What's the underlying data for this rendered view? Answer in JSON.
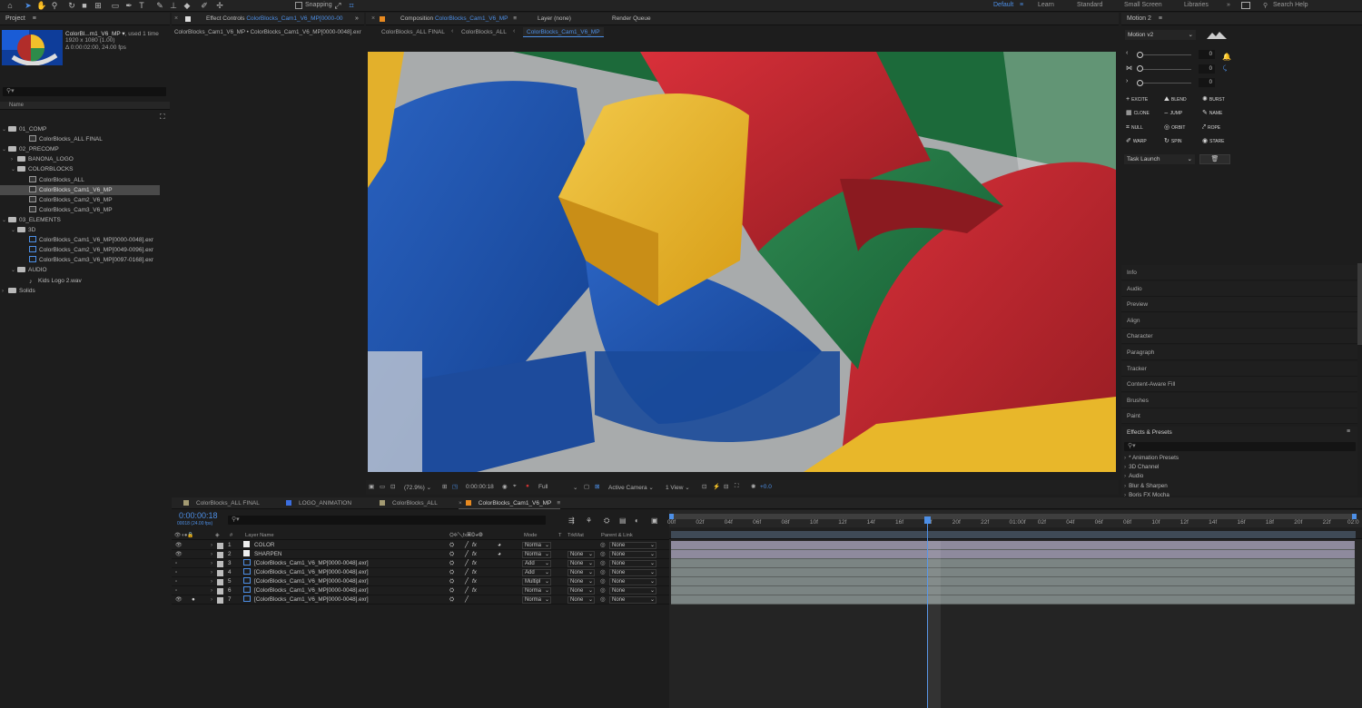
{
  "toolbar": {
    "snapping_label": "Snapping",
    "workspaces": [
      "Default",
      "Learn",
      "Standard",
      "Small Screen",
      "Libraries"
    ],
    "active_workspace": "Default",
    "search_placeholder": "Search Help"
  },
  "project": {
    "panel_title": "Project",
    "item_name": "ColorBl...m1_V6_MP ▾",
    "used": ", used 1 time",
    "dimensions": "1920 x 1080 (1.00)",
    "duration": "Δ 0:00:02:00, 24.00 fps",
    "column_name": "Name",
    "tree": [
      {
        "label": "01_COMP",
        "indent": 0,
        "kind": "folder",
        "open": true
      },
      {
        "label": "ColorBlocks_ALL FINAL",
        "indent": 2,
        "kind": "comp"
      },
      {
        "label": "02_PRECOMP",
        "indent": 0,
        "kind": "folder",
        "open": true
      },
      {
        "label": "BANONA_LOGO",
        "indent": 1,
        "kind": "folder",
        "open": false
      },
      {
        "label": "COLORBLOCKS",
        "indent": 1,
        "kind": "folder",
        "open": true
      },
      {
        "label": "ColorBlocks_ALL",
        "indent": 2,
        "kind": "comp"
      },
      {
        "label": "ColorBlocks_Cam1_V6_MP",
        "indent": 2,
        "kind": "comp",
        "selected": true
      },
      {
        "label": "ColorBlocks_Cam2_V6_MP",
        "indent": 2,
        "kind": "comp"
      },
      {
        "label": "ColorBlocks_Cam3_V6_MP",
        "indent": 2,
        "kind": "comp"
      },
      {
        "label": "03_ELEMENTS",
        "indent": 0,
        "kind": "folder",
        "open": true
      },
      {
        "label": "3D",
        "indent": 1,
        "kind": "folder",
        "open": true
      },
      {
        "label": "ColorBlocks_Cam1_V6_MP[0000-0048].exr",
        "indent": 2,
        "kind": "footage"
      },
      {
        "label": "ColorBlocks_Cam2_V6_MP[0049-0096].exr",
        "indent": 2,
        "kind": "footage"
      },
      {
        "label": "ColorBlocks_Cam3_V6_MP[0097-0168].exr",
        "indent": 2,
        "kind": "footage"
      },
      {
        "label": "AUDIO",
        "indent": 1,
        "kind": "folder",
        "open": true
      },
      {
        "label": "Kids Logo 2.wav",
        "indent": 2,
        "kind": "audio"
      },
      {
        "label": "Solids",
        "indent": 0,
        "kind": "folder",
        "open": false
      }
    ]
  },
  "effect_controls": {
    "tab_label": "Effect Controls",
    "tab_target": "ColorBlocks_Cam1_V6_MP[0000-00",
    "breadcrumb": "ColorBlocks_Cam1_V6_MP • ColorBlocks_Cam1_V6_MP[0000-0048].exr"
  },
  "composition": {
    "tab_label": "Composition",
    "tab_target": "ColorBlocks_Cam1_V6_MP",
    "layer_tab": "Layer (none)",
    "render_queue_tab": "Render Queue",
    "flow": [
      "ColorBlocks_ALL FINAL",
      "ColorBlocks_ALL",
      "ColorBlocks_Cam1_V6_MP"
    ],
    "footer": {
      "zoom": "(72.9%)",
      "timecode": "0:00:00:18",
      "resolution": "Full",
      "camera": "Active Camera",
      "views": "1 View",
      "exposure": "+0.0"
    }
  },
  "motion": {
    "panel_title": "Motion 2",
    "preset": "Motion v2",
    "sliders": [
      "0",
      "0",
      "0"
    ],
    "buttons": [
      [
        "EXCITE",
        "BLEND",
        "BURST"
      ],
      [
        "CLONE",
        "JUMP",
        "NAME"
      ],
      [
        "NULL",
        "ORBIT",
        "ROPE"
      ],
      [
        "WARP",
        "SPIN",
        "STARE"
      ]
    ],
    "task": "Task Launch"
  },
  "side_panels": [
    "Info",
    "Audio",
    "Preview",
    "Align",
    "Character",
    "Paragraph",
    "Tracker",
    "Content-Aware Fill",
    "Brushes",
    "Paint"
  ],
  "effects_presets": {
    "title": "Effects & Presets",
    "items": [
      "* Animation Presets",
      "3D Channel",
      "Audio",
      "Blur & Sharpen",
      "Boris FX Mocha"
    ]
  },
  "timeline": {
    "tabs": [
      {
        "label": "ColorBlocks_ALL FINAL",
        "color": "#a39a72"
      },
      {
        "label": "LOGO_ANIMATION",
        "color": "#3b6ee0"
      },
      {
        "label": "ColorBlocks_ALL",
        "color": "#a39a72"
      },
      {
        "label": "ColorBlocks_Cam1_V6_MP",
        "color": "#e88a20",
        "active": true
      }
    ],
    "timecode": "0:00:00:18",
    "frames_fps": "00018 (24.00 fps)",
    "columns": {
      "layer_name": "Layer Name",
      "mode": "Mode",
      "t": "T",
      "trkmat": "TrkMat",
      "parent": "Parent & Link"
    },
    "layers": [
      {
        "num": "1",
        "name": "COLOR",
        "kind": "solid",
        "mode": "Norma",
        "trkmat": "",
        "parent": "None",
        "fx": true,
        "adj": true
      },
      {
        "num": "2",
        "name": "SHARPEN",
        "kind": "solid",
        "mode": "Norma",
        "trkmat": "None",
        "parent": "None",
        "fx": true,
        "adj": true
      },
      {
        "num": "3",
        "name": "[ColorBlocks_Cam1_V6_MP[0000-0048].exr]",
        "kind": "footage",
        "mode": "Add",
        "trkmat": "None",
        "parent": "None",
        "fx": true
      },
      {
        "num": "4",
        "name": "[ColorBlocks_Cam1_V6_MP[0000-0048].exr]",
        "kind": "footage",
        "mode": "Add",
        "trkmat": "None",
        "parent": "None",
        "fx": true
      },
      {
        "num": "5",
        "name": "[ColorBlocks_Cam1_V6_MP[0000-0048].exr]",
        "kind": "footage",
        "mode": "Multipl",
        "trkmat": "None",
        "parent": "None",
        "fx": true
      },
      {
        "num": "6",
        "name": "[ColorBlocks_Cam1_V6_MP[0000-0048].exr]",
        "kind": "footage",
        "mode": "Norma",
        "trkmat": "None",
        "parent": "None",
        "fx": true
      },
      {
        "num": "7",
        "name": "[ColorBlocks_Cam1_V6_MP[0000-0048].exr]",
        "kind": "footage",
        "mode": "Norma",
        "trkmat": "None",
        "parent": "None",
        "fx": false
      }
    ],
    "ruler": [
      "00f",
      "02f",
      "04f",
      "06f",
      "08f",
      "10f",
      "12f",
      "14f",
      "16f",
      "18f",
      "20f",
      "22f",
      "01:00f",
      "02f",
      "04f",
      "06f",
      "08f",
      "10f",
      "12f",
      "14f",
      "16f",
      "18f",
      "20f",
      "22f",
      "02:0"
    ],
    "playhead_frame": 18,
    "total_frames": 48
  },
  "colors": {
    "accent": "#4d8fe6",
    "panel_bg": "#1d1d1d",
    "header_bg": "#232323"
  }
}
